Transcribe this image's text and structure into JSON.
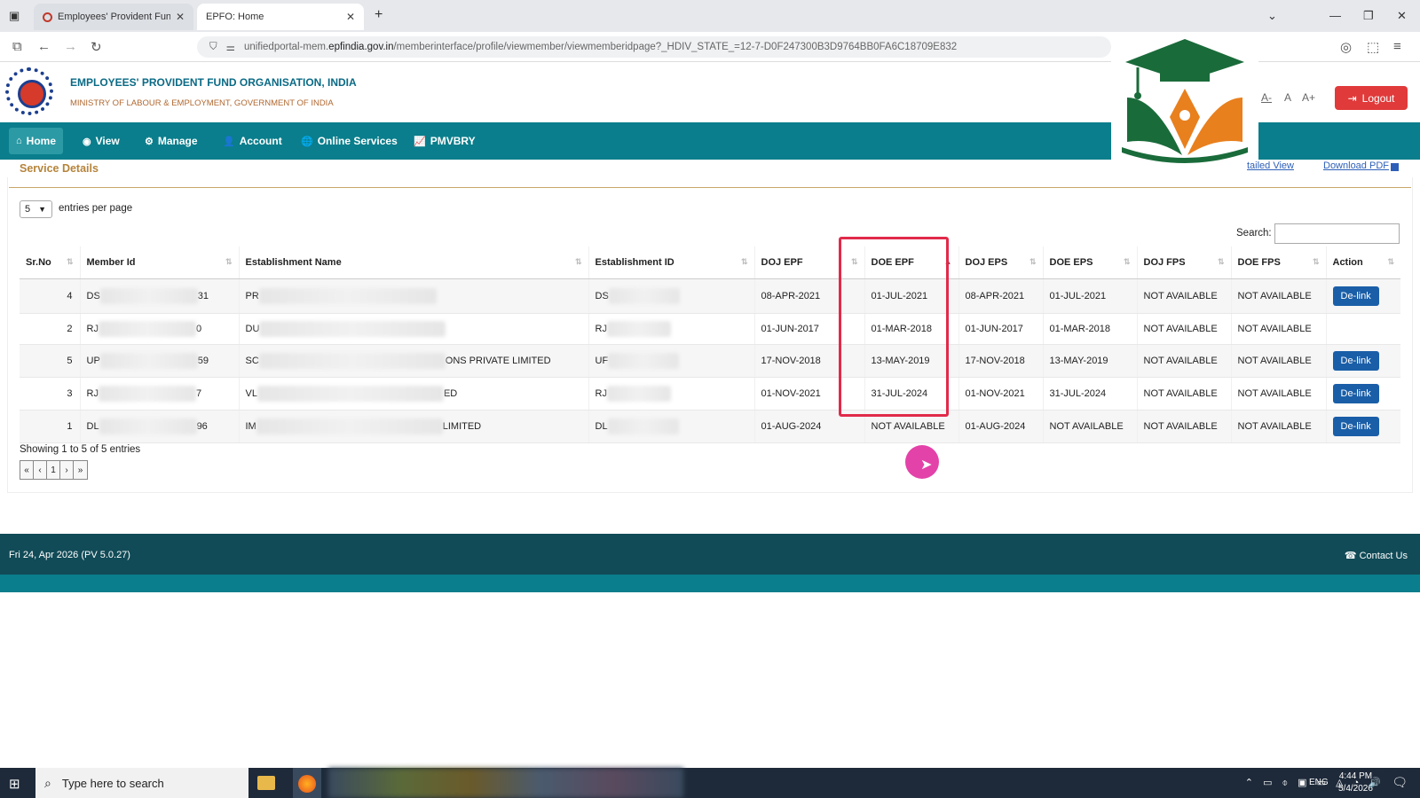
{
  "browser": {
    "tabs": [
      {
        "title": "Employees' Provident Fund Org"
      },
      {
        "title": "EPFO: Home"
      }
    ],
    "new_tab": "+",
    "url_domain_prefix": "unifiedportal-mem.",
    "url_domain": "epfindia.gov.in",
    "url_path": "/memberinterface/profile/viewmember/viewmemberidpage?_HDIV_STATE_=12-7-D0F247300B3D9764BB0FA6C18709E832"
  },
  "header": {
    "org_name": "EMPLOYEES' PROVIDENT FUND ORGANISATION, INDIA",
    "ministry": "MINISTRY OF LABOUR & EMPLOYMENT, GOVERNMENT OF INDIA",
    "font_small": "A-",
    "font_normal": "A",
    "font_large": "A+",
    "logout": "Logout"
  },
  "nav": {
    "items": [
      {
        "icon": "⌂",
        "label": "Home"
      },
      {
        "icon": "◉",
        "label": "View"
      },
      {
        "icon": "⚙",
        "label": "Manage"
      },
      {
        "icon": "👤",
        "label": "Account"
      },
      {
        "icon": "🌐",
        "label": "Online Services"
      },
      {
        "icon": "📈",
        "label": "PMVBRY"
      }
    ]
  },
  "service": {
    "title": "Service Details",
    "detailed_view": "tailed View",
    "download_pdf": "Download PDF",
    "per_page_value": "5",
    "per_page_label": "entries per page",
    "search_label": "Search:",
    "columns": [
      "Sr.No",
      "Member Id",
      "Establishment Name",
      "Establishment ID",
      "DOJ EPF",
      "DOE EPF",
      "DOJ EPS",
      "DOE EPS",
      "DOJ FPS",
      "DOE FPS",
      "Action"
    ],
    "rows": [
      {
        "sr": "4",
        "mid_pre": "DS",
        "mid_suf": "31",
        "ename_pre": "PR",
        "ename_suf": "",
        "eid_pre": "DS",
        "doj_epf": "08-APR-2021",
        "doe_epf": "01-JUL-2021",
        "doj_eps": "08-APR-2021",
        "doe_eps": "01-JUL-2021",
        "doj_fps": "NOT AVAILABLE",
        "doe_fps": "NOT AVAILABLE",
        "action": "De-link"
      },
      {
        "sr": "2",
        "mid_pre": "RJ",
        "mid_suf": "0",
        "ename_pre": "DU",
        "ename_suf": "",
        "eid_pre": "RJ",
        "doj_epf": "01-JUN-2017",
        "doe_epf": "01-MAR-2018",
        "doj_eps": "01-JUN-2017",
        "doe_eps": "01-MAR-2018",
        "doj_fps": "NOT AVAILABLE",
        "doe_fps": "NOT AVAILABLE",
        "action": ""
      },
      {
        "sr": "5",
        "mid_pre": "UP",
        "mid_suf": "59",
        "ename_pre": "SC",
        "ename_suf": "ONS PRIVATE LIMITED",
        "eid_pre": "UF",
        "doj_epf": "17-NOV-2018",
        "doe_epf": "13-MAY-2019",
        "doj_eps": "17-NOV-2018",
        "doe_eps": "13-MAY-2019",
        "doj_fps": "NOT AVAILABLE",
        "doe_fps": "NOT AVAILABLE",
        "action": "De-link"
      },
      {
        "sr": "3",
        "mid_pre": "RJ",
        "mid_suf": "7",
        "ename_pre": "VL",
        "ename_suf": "ED",
        "eid_pre": "RJ",
        "doj_epf": "01-NOV-2021",
        "doe_epf": "31-JUL-2024",
        "doj_eps": "01-NOV-2021",
        "doe_eps": "31-JUL-2024",
        "doj_fps": "NOT AVAILABLE",
        "doe_fps": "NOT AVAILABLE",
        "action": "De-link"
      },
      {
        "sr": "1",
        "mid_pre": "DL",
        "mid_suf": "96",
        "ename_pre": "IM",
        "ename_suf": "LIMITED",
        "eid_pre": "DL",
        "doj_epf": "01-AUG-2024",
        "doe_epf": "NOT AVAILABLE",
        "doj_eps": "01-AUG-2024",
        "doe_eps": "NOT AVAILABLE",
        "doj_fps": "NOT AVAILABLE",
        "doe_fps": "NOT AVAILABLE",
        "action": "De-link"
      }
    ],
    "showing": "Showing 1 to 5 of 5 entries",
    "pager": [
      "«",
      "‹",
      "1",
      "›",
      "»"
    ]
  },
  "footer": {
    "date": "Fri 24, Apr 2026 (PV 5.0.27)",
    "contact": "Contact Us"
  },
  "taskbar": {
    "search_placeholder": "Type here to search",
    "lang": "ENG",
    "time": "4:44 PM",
    "date": "5/4/2026"
  },
  "colors": {
    "nav_bg": "#0a7e8c",
    "footer_bg": "#114b57",
    "logout_bg": "#e03a3a",
    "highlight": "#e12a4a",
    "button": "#1a5ea8"
  }
}
